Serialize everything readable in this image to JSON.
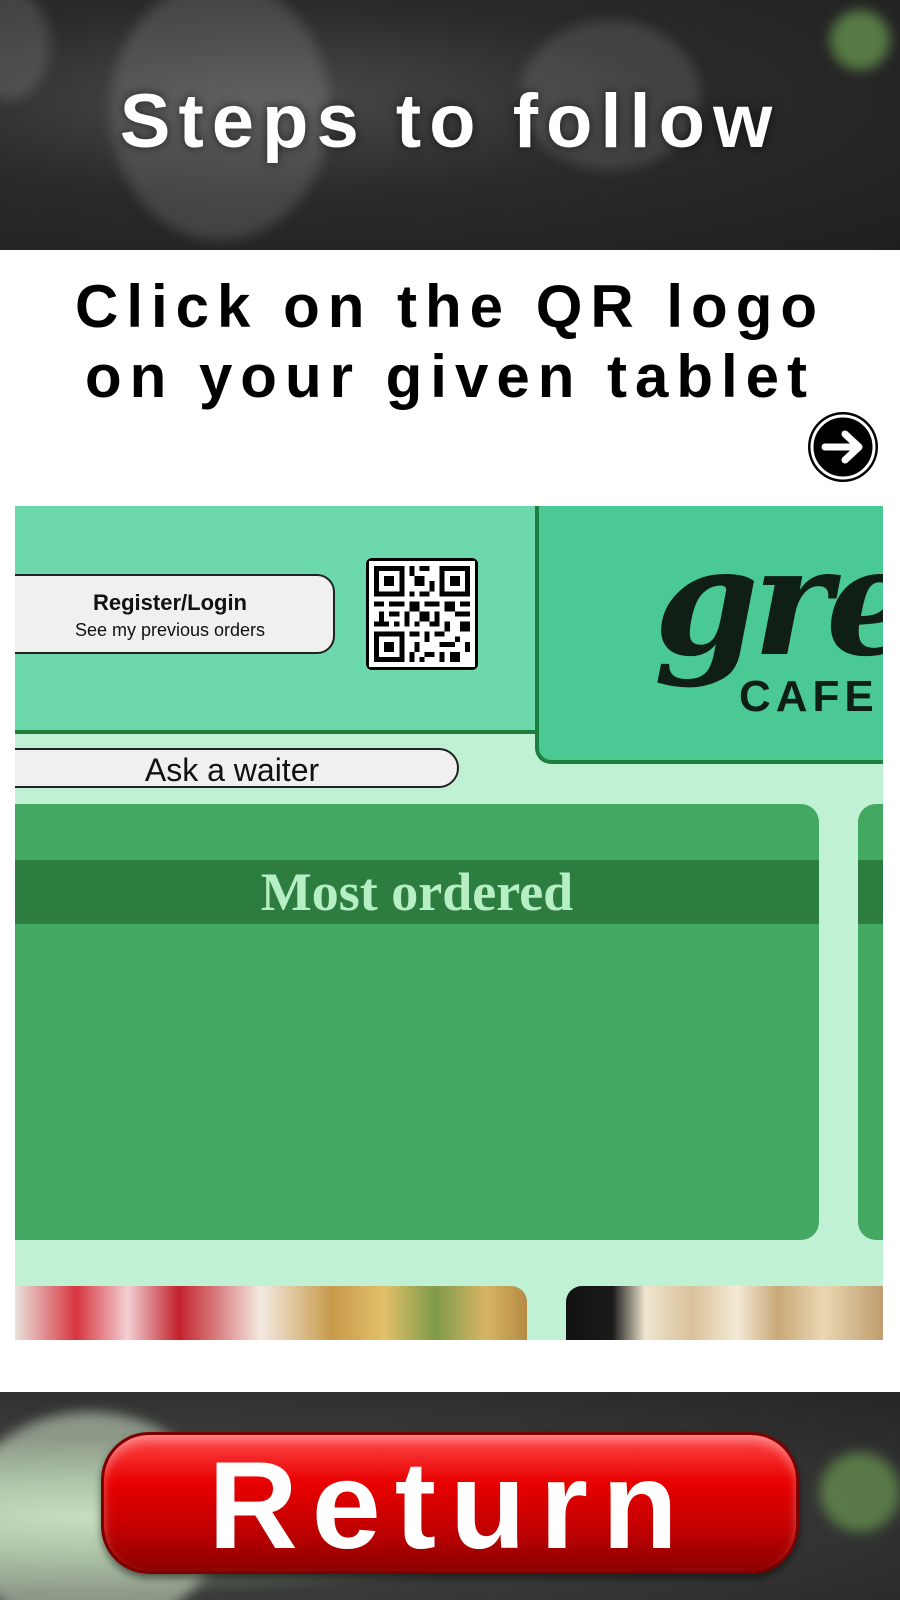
{
  "header": {
    "title": "Steps to follow"
  },
  "instruction": {
    "line1": "Click on the QR logo",
    "line2": "on your given tablet"
  },
  "next_arrow": {
    "icon": "arrow-right-icon"
  },
  "preview": {
    "register": {
      "title": "Register/Login",
      "subtitle": "See my previous orders"
    },
    "qr": {
      "icon": "qr-code-icon"
    },
    "logo": {
      "script": "gre",
      "subtitle": "CAFE"
    },
    "waiter": {
      "label": "Ask a waiter"
    },
    "most_ordered": {
      "title": "Most ordered"
    }
  },
  "footer": {
    "return_label": "Return"
  },
  "colors": {
    "accent_green": "#43a862",
    "dark_green": "#2e7d40",
    "light_green": "#c1f1d4",
    "return_red": "#e80000"
  }
}
